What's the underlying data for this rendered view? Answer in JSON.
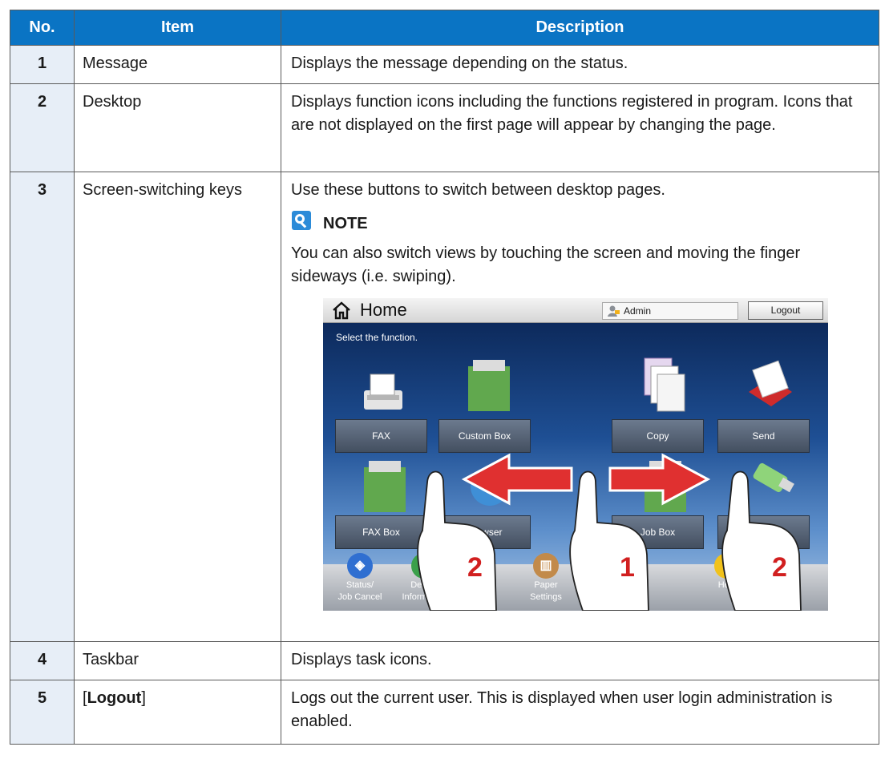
{
  "table": {
    "headers": [
      "No.",
      "Item",
      "Description"
    ],
    "rows": [
      {
        "no": "1",
        "item": "Message",
        "desc": "Displays the message depending on the status."
      },
      {
        "no": "2",
        "item": "Desktop",
        "desc": "Displays function icons including the functions registered in program. Icons that are not displayed on the first page will appear by changing the page."
      },
      {
        "no": "3",
        "item": "Screen-switching keys",
        "desc": "Use these buttons to switch between desktop pages.",
        "note_title": "NOTE",
        "note_text": "You can also switch views by touching the screen and moving the finger sideways (i.e. swiping)."
      },
      {
        "no": "4",
        "item": "Taskbar",
        "desc": "Displays task icons."
      },
      {
        "no": "5",
        "item_bracket_open": "[",
        "item_bold": "Logout",
        "item_bracket_close": "]",
        "desc": "Logs out the current user. This is displayed when user login administration is enabled."
      }
    ]
  },
  "home": {
    "title": "Home",
    "user": "Admin",
    "logout": "Logout",
    "prompt": "Select the function.",
    "functions": [
      "FAX",
      "Custom Box",
      "Copy",
      "Send",
      "FAX Box",
      "Browser",
      "Job Box",
      ""
    ],
    "task_items": [
      {
        "label1": "Status/",
        "label2": "Job Cancel",
        "color": "#2f6fd1"
      },
      {
        "label1": "Device",
        "label2": "Information",
        "color": "#3aa04a"
      },
      {
        "label1": "Paper",
        "label2": "Settings",
        "color": "#c28a4a"
      },
      {
        "label1": "Help",
        "label2": "",
        "color": "#f1c21b"
      }
    ],
    "swipe_numbers": [
      "2",
      "1",
      "2"
    ]
  }
}
